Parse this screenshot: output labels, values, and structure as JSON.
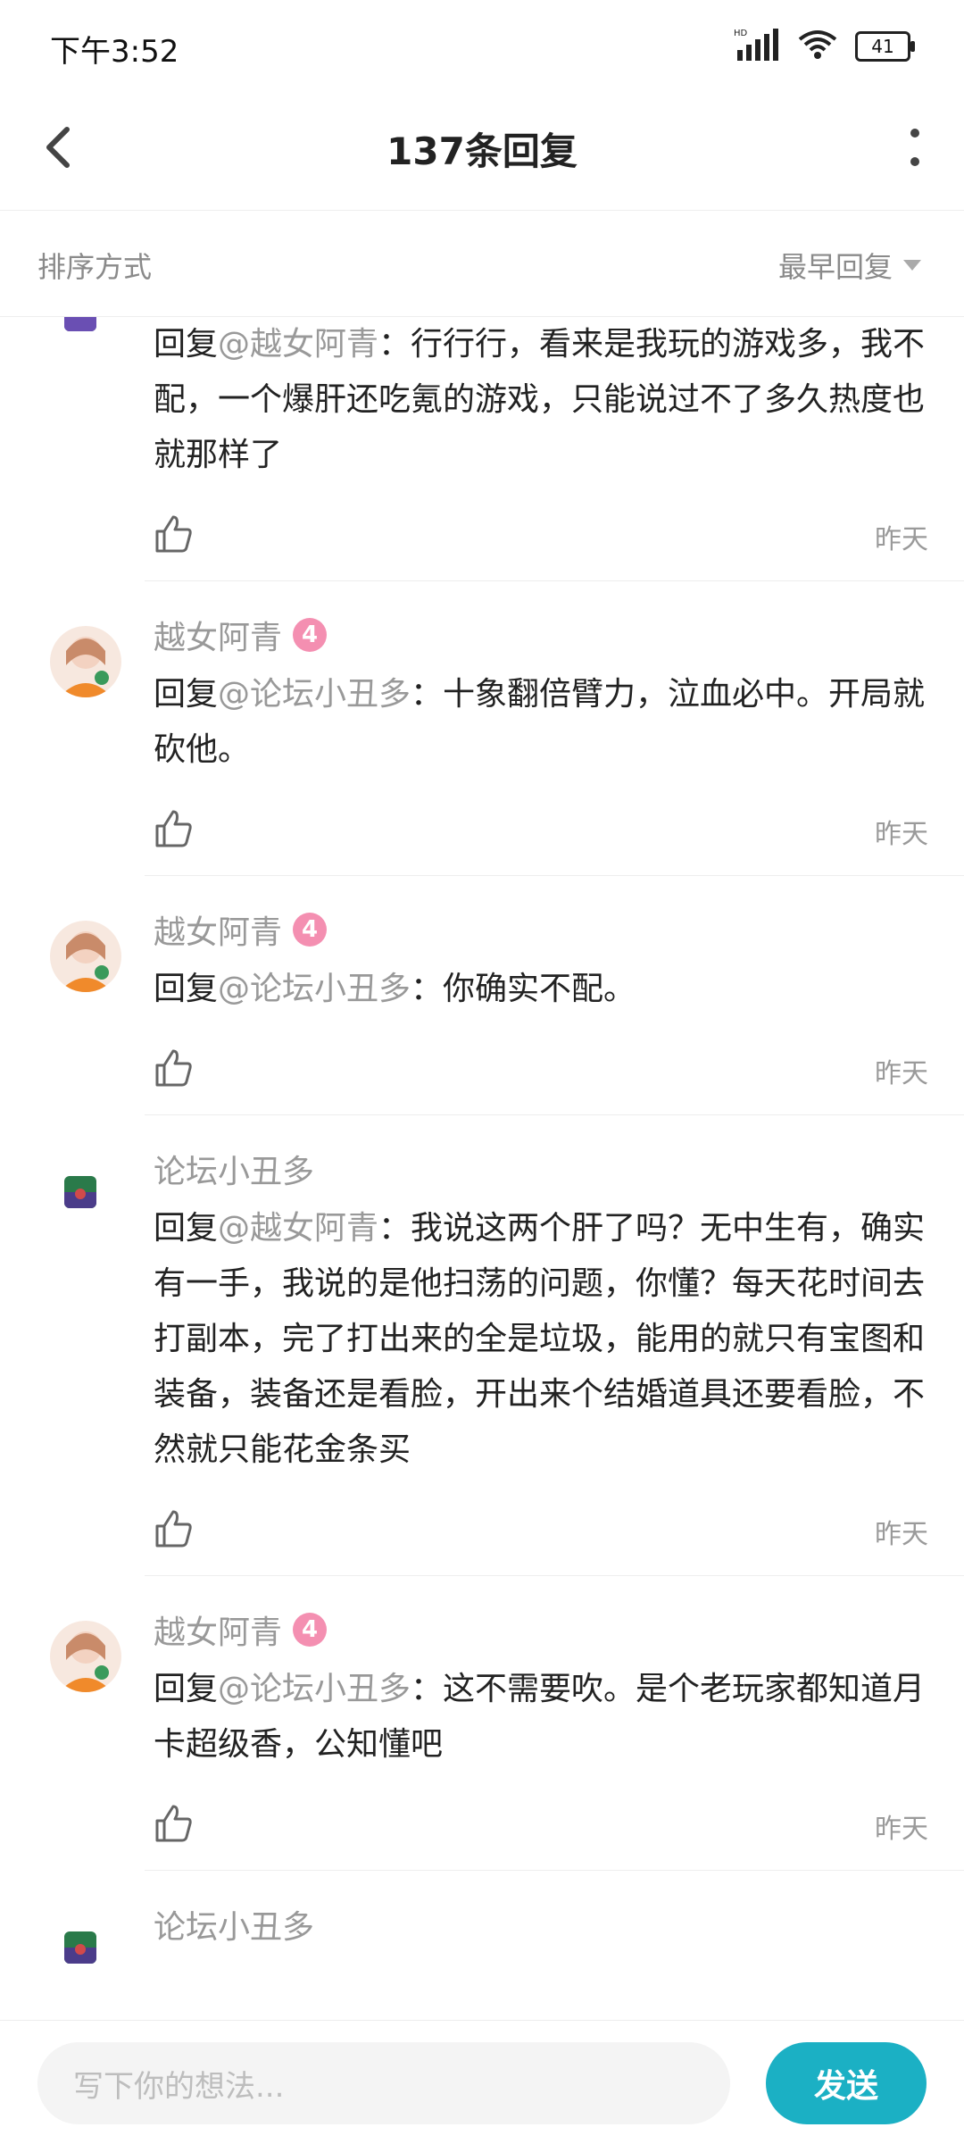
{
  "status": {
    "time": "下午3:52",
    "battery": "41",
    "network_label": "HD"
  },
  "header": {
    "title": "137条回复"
  },
  "sort": {
    "label": "排序方式",
    "value": "最早回复"
  },
  "replies": [
    {
      "author": "",
      "level": "",
      "prefix": "回复",
      "mention": "@越女阿青",
      "text": "：行行行，看来是我玩的游戏多，我不配，一个爆肝还吃氪的游戏，只能说过不了多久热度也就那样了",
      "time": "昨天"
    },
    {
      "author": "越女阿青",
      "level": "4",
      "prefix": "回复",
      "mention": "@论坛小丑多",
      "text": "：十象翻倍臂力，泣血必中。开局就砍他。",
      "time": "昨天"
    },
    {
      "author": "越女阿青",
      "level": "4",
      "prefix": "回复",
      "mention": "@论坛小丑多",
      "text": "：你确实不配。",
      "time": "昨天"
    },
    {
      "author": "论坛小丑多",
      "level": "",
      "prefix": "回复",
      "mention": "@越女阿青",
      "text": "：我说这两个肝了吗？无中生有，确实有一手，我说的是他扫荡的问题，你懂？每天花时间去打副本，完了打出来的全是垃圾，能用的就只有宝图和装备，装备还是看脸，开出来个结婚道具还要看脸，不然就只能花金条买",
      "time": "昨天"
    },
    {
      "author": "越女阿青",
      "level": "4",
      "prefix": "回复",
      "mention": "@论坛小丑多",
      "text": "：这不需要吹。是个老玩家都知道月卡超级香，公知懂吧",
      "time": "昨天"
    },
    {
      "author": "论坛小丑多",
      "level": "",
      "prefix": "",
      "mention": "",
      "text": "",
      "time": ""
    }
  ],
  "composer": {
    "placeholder": "写下你的想法...",
    "send_label": "发送"
  },
  "colors": {
    "accent": "#1bb0c4",
    "level_badge": "#f48fb1"
  }
}
